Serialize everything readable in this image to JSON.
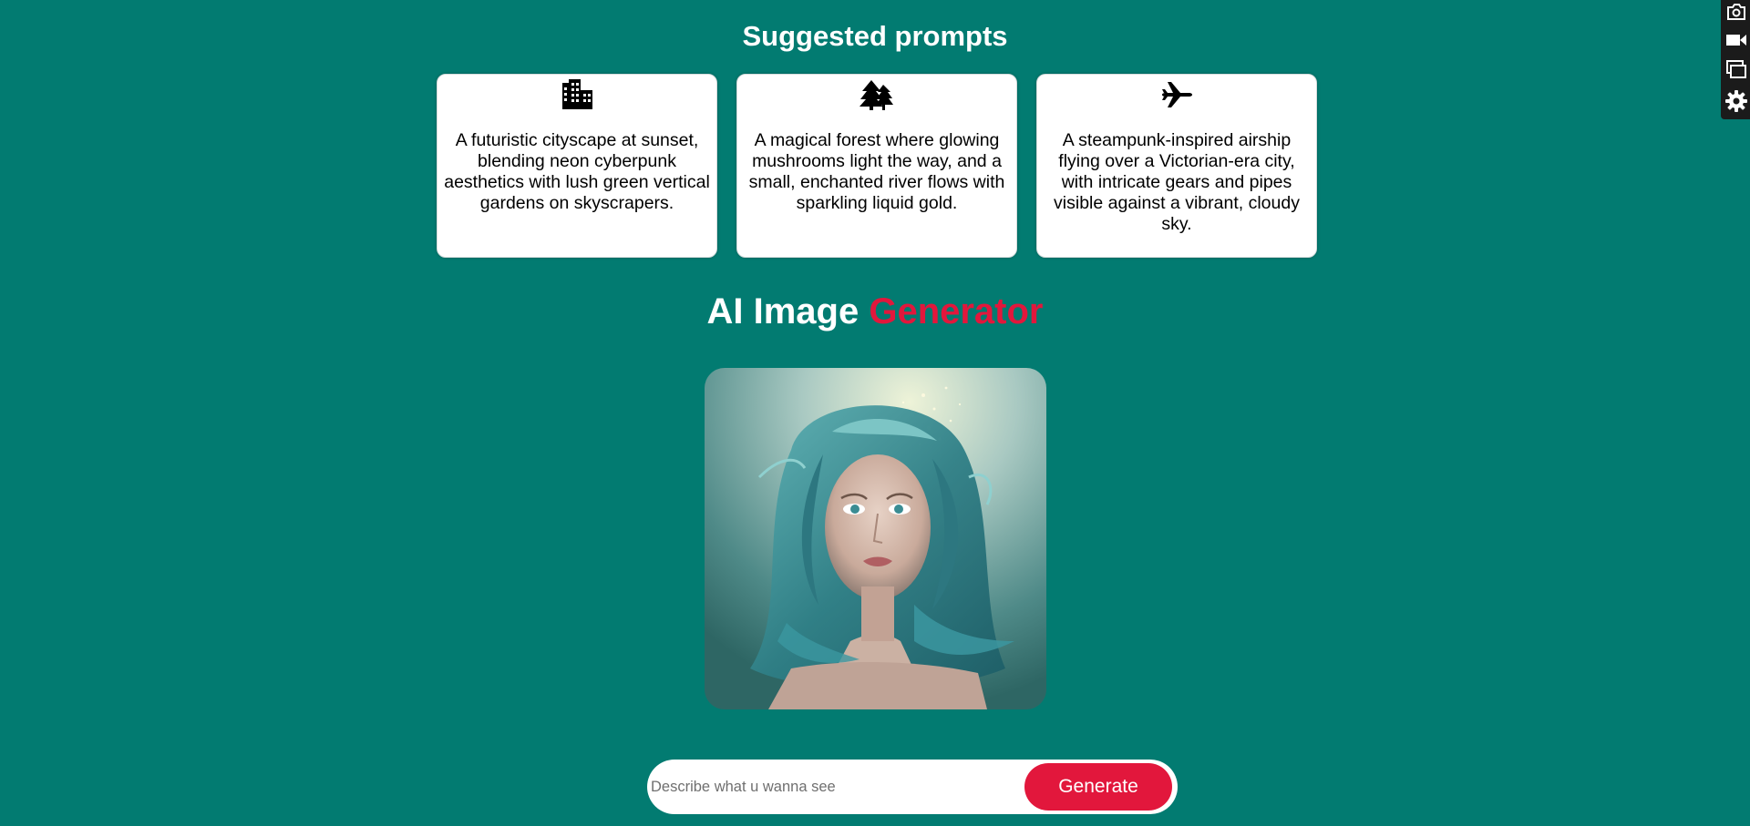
{
  "suggested": {
    "title": "Suggested prompts",
    "cards": [
      {
        "icon": "city-buildings-icon",
        "text": "A futuristic cityscape at sunset, blending neon cyberpunk aesthetics with lush green vertical gardens on skyscrapers."
      },
      {
        "icon": "pine-trees-icon",
        "text": "A magical forest where glowing mushrooms light the way, and a small, enchanted river flows with sparkling liquid gold."
      },
      {
        "icon": "airplane-icon",
        "text": "A steampunk-inspired airship flying over a Victorian-era city, with intricate gears and pipes visible against a vibrant, cloudy sky."
      }
    ]
  },
  "generator": {
    "title_part1": "AI Image",
    "title_part2": "Generator",
    "image_subject": "teal-haired woman portrait"
  },
  "prompt_bar": {
    "placeholder": "Describe what u wanna see",
    "value": "",
    "button_label": "Generate"
  },
  "toolbar": {
    "icons": [
      "camera-icon",
      "video-camera-icon",
      "windows-icon",
      "gear-icon"
    ]
  },
  "colors": {
    "background": "#027b71",
    "accent": "#e2173c",
    "card": "#ffffff"
  }
}
